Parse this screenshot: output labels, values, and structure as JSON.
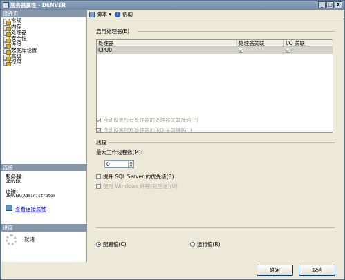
{
  "window": {
    "title": "服务器属性 - DENVER",
    "controls": [
      "_",
      "□",
      "X"
    ]
  },
  "left_pane": {
    "select_page_header": "选择页",
    "pages": [
      "常规",
      "内存",
      "处理器",
      "安全性",
      "连接",
      "数据库设置",
      "高级",
      "权限"
    ],
    "connection_header": "连接",
    "server_label": "服务器:",
    "server_value": "DENVER",
    "connection_label": "连接:",
    "connection_value": "DENVER\\Administrator",
    "view_connection_link": "查看连接属性",
    "progress_header": "进度",
    "progress_status": "就绪"
  },
  "toolbar": {
    "script_label": "脚本",
    "help_label": "帮助"
  },
  "processor": {
    "enable_group_label": "启用处理器(E)",
    "grid_headers": [
      "处理器",
      "处理器关联",
      "I/O 关联"
    ],
    "rows": [
      {
        "name": "CPU0",
        "affinity": true,
        "io_affinity": true
      }
    ],
    "auto_affinity_label": "自动设置所有处理器的处理器关联掩码(P)",
    "auto_io_affinity_label": "自动设置所有处理器的 I/O 关联掩码(I)",
    "auto_affinity_checked": true,
    "auto_io_affinity_checked": true
  },
  "threads": {
    "group_label": "线程",
    "max_worker_label": "最大工作线程数(M):",
    "max_worker_value": "0",
    "boost_priority_label": "提升 SQL Server 的优先级(B)",
    "boost_priority_checked": false,
    "use_fibers_label": "使用 Windows 纤程(轻型池)(U)",
    "use_fibers_checked": false
  },
  "value_mode": {
    "configured_label": "配置值(C)",
    "running_label": "运行值(R)",
    "selected": "configured"
  },
  "buttons": {
    "ok": "确定",
    "cancel": "取消"
  },
  "colors": {
    "title_bar": "#7a93b1",
    "section_header": "#8797aa",
    "link": "#0000c8",
    "dialog_background": "#ece9d8"
  }
}
